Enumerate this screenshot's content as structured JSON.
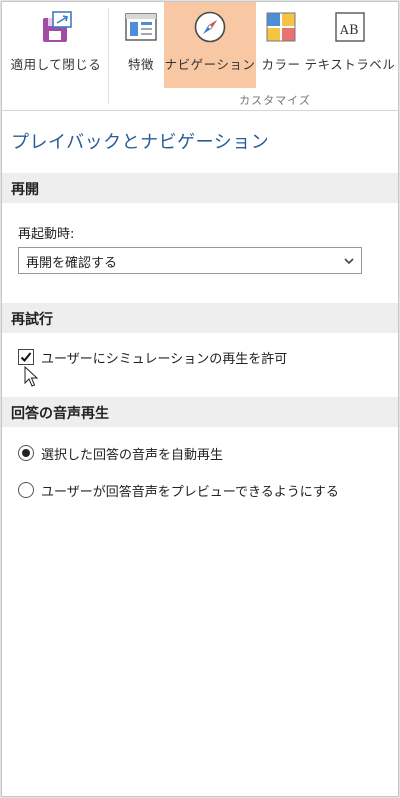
{
  "ribbon": {
    "apply_close": "適用して閉じる",
    "features": "特徴",
    "navigation": "ナビゲーション",
    "color": "カラー",
    "text_label": "テキストラベル",
    "group_label": "カスタマイズ",
    "active_color": "#f8c7a3"
  },
  "page": {
    "title": "プレイバックとナビゲーション"
  },
  "resume": {
    "header": "再開",
    "field_label": "再起動時:",
    "selected": "再開を確認する"
  },
  "retry": {
    "header": "再試行",
    "checkbox_label": "ユーザーにシミュレーションの再生を許可",
    "checked": true
  },
  "answer_audio": {
    "header": "回答の音声再生",
    "options": [
      {
        "label": "選択した回答の音声を自動再生",
        "selected": true
      },
      {
        "label": "ユーザーが回答音声をプレビューできるようにする",
        "selected": false
      }
    ]
  },
  "colors": {
    "title": "#2b5c9a",
    "section_bg": "#eeeeee"
  }
}
